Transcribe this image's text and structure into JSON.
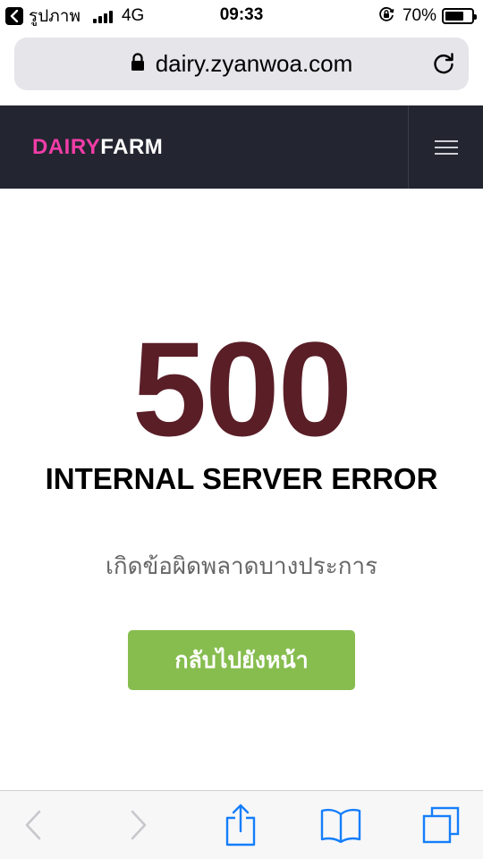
{
  "status_bar": {
    "back_app": "รูปภาพ",
    "network": "4G",
    "time": "09:33",
    "battery_percent": "70%",
    "battery_level": 0.7
  },
  "browser": {
    "url": "dairy.zyanwoa.com"
  },
  "site": {
    "logo_part1": "DAIRY",
    "logo_part2": "FARM"
  },
  "error": {
    "code": "500",
    "title": "INTERNAL SERVER ERROR",
    "message": "เกิดข้อผิดพลาดบางประการ",
    "back_button": "กลับไปยังหน้า"
  },
  "colors": {
    "header_bg": "#232530",
    "logo_accent": "#f03da6",
    "error_code": "#5a1e27",
    "button": "#87bd4f",
    "ios_blue": "#147efb"
  }
}
